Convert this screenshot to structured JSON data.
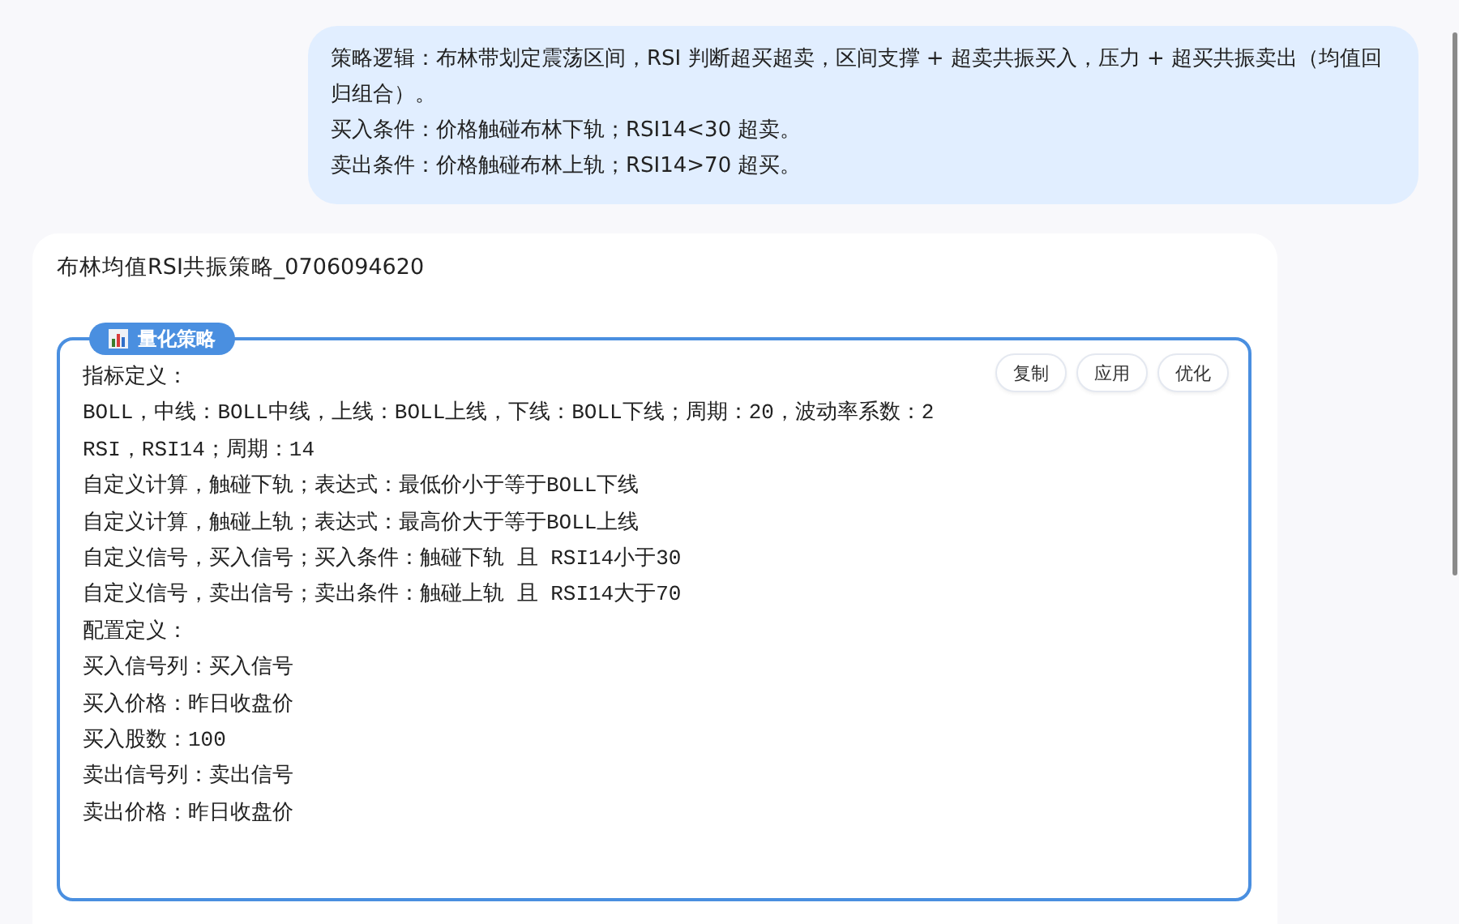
{
  "user_message": {
    "lines": [
      "策略逻辑：布林带划定震荡区间，RSI 判断超买超卖，区间支撑 + 超卖共振买入，压力 + 超买共振卖出（均值回归组合）。",
      "买入条件：价格触碰布林下轨；RSI14<30 超卖。",
      "卖出条件：价格触碰布林上轨；RSI14>70 超买。"
    ]
  },
  "reply": {
    "title": "布林均值RSI共振策略_0706094620",
    "block": {
      "badge": "量化策略",
      "buttons": [
        "复制",
        "应用",
        "优化"
      ],
      "lines": [
        "指标定义：",
        "BOLL，中线：BOLL中线，上线：BOLL上线，下线：BOLL下线；周期：20，波动率系数：2",
        "RSI，RSI14；周期：14",
        "自定义计算，触碰下轨；表达式：最低价小于等于BOLL下线",
        "自定义计算，触碰上轨；表达式：最高价大于等于BOLL上线",
        "自定义信号，买入信号；买入条件：触碰下轨 且 RSI14小于30",
        "自定义信号，卖出信号；卖出条件：触碰上轨 且 RSI14大于70",
        "配置定义：",
        "买入信号列：买入信号",
        "买入价格：昨日收盘价",
        "买入股数：100",
        "卖出信号列：卖出信号",
        "卖出价格：昨日收盘价"
      ]
    }
  }
}
